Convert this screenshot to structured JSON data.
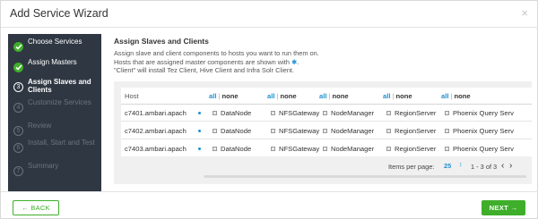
{
  "window": {
    "title": "Add Service Wizard",
    "close_glyph": "×"
  },
  "steps": [
    {
      "label": "Choose Services",
      "state": "done",
      "marker": ""
    },
    {
      "label": "Assign Masters",
      "state": "done",
      "marker": ""
    },
    {
      "label": "Assign Slaves and Clients",
      "state": "current",
      "marker": "3"
    },
    {
      "label": "Customize Services",
      "state": "pending",
      "marker": "4"
    },
    {
      "label": "Review",
      "state": "pending",
      "marker": "5"
    },
    {
      "label": "Install, Start and Test",
      "state": "pending",
      "marker": "6"
    },
    {
      "label": "Summary",
      "state": "pending",
      "marker": "7"
    }
  ],
  "main": {
    "heading": "Assign Slaves and Clients",
    "desc_line1": "Assign slave and client components to hosts you want to run them on.",
    "desc_line2": "Hosts that are assigned master components are shown with",
    "desc_star": "✱",
    "desc_line2_end": ".",
    "desc_line3": "\"Client\" will install Tez Client, Hive Client and Infra Solr Client."
  },
  "grid": {
    "host_header": "Host",
    "all_label": "all",
    "none_label": "none",
    "sep": "|",
    "rows": [
      {
        "host": "c7401.ambari.apach",
        "c1": "DataNode",
        "c2": "NFSGateway",
        "c3": "NodeManager",
        "c4": "RegionServer",
        "c5": "Phoenix Query Serv"
      },
      {
        "host": "c7402.ambari.apach",
        "c1": "DataNode",
        "c2": "NFSGateway",
        "c3": "NodeManager",
        "c4": "RegionServer",
        "c5": "Phoenix Query Serv"
      },
      {
        "host": "c7403.ambari.apach",
        "c1": "DataNode",
        "c2": "NFSGateway",
        "c3": "NodeManager",
        "c4": "RegionServer",
        "c5": "Phoenix Query Serv"
      }
    ]
  },
  "pager": {
    "label": "Items per page:",
    "size": "25",
    "caret": "↕",
    "range": "1 - 3 of 3",
    "prev": "‹",
    "next": "›"
  },
  "footer": {
    "back_label": "← BACK",
    "next_label": "NEXT →"
  },
  "colors": {
    "accent": "#3fae2a",
    "link": "#1e91cf",
    "sidebar": "#2f3742"
  }
}
